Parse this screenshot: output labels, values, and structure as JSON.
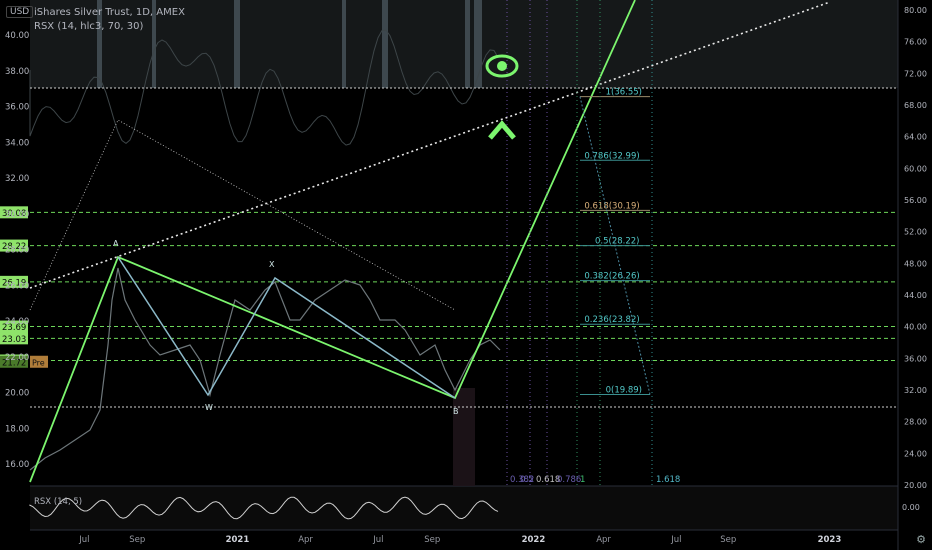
{
  "header": {
    "symbol_line": "iShares Silver Trust, 1D, AMEX",
    "indicator_line": "RSX (14, hlc3, 70, 30)",
    "currency": "USD"
  },
  "colors": {
    "bg": "#000000",
    "accent": "#7cf56e",
    "level": "#6dd65a",
    "fib_text": "#d8b07a",
    "fib_text_alt": "#52c7c7",
    "rsx_band": "#5e6f73"
  },
  "chart_data": {
    "type": "line",
    "price_axis_ticks": [
      16.0,
      18.0,
      20.0,
      22.0,
      24.0,
      26.0,
      28.0,
      30.0,
      32.0,
      34.0,
      36.0,
      38.0,
      40.0
    ],
    "rsx_axis_ticks": [
      "80.00",
      "76.00",
      "72.00",
      "68.00",
      "64.00",
      "60.00",
      "56.00",
      "52.00",
      "48.00",
      "44.00",
      "40.00",
      "36.00",
      "32.00",
      "28.00",
      "24.00",
      "20.00"
    ],
    "lower_pane_tick": "0.00",
    "time_labels": [
      "Jul",
      "Sep",
      "2021",
      "Apr",
      "Jul",
      "Sep",
      "2022",
      "Apr",
      "Jul",
      "Sep",
      "2023"
    ],
    "level_badges": [
      {
        "label": "30.08",
        "value": 30.08
      },
      {
        "label": "28.22",
        "value": 28.22
      },
      {
        "label": "26.19",
        "value": 26.19
      },
      {
        "label": "23.69",
        "value": 23.69
      },
      {
        "label": "23.03",
        "value": 23.03
      },
      {
        "label": "21.79",
        "value": 21.79
      },
      {
        "label": "21.72",
        "value": 21.72
      }
    ],
    "fib_levels": [
      {
        "label": "1(36.55)",
        "value": 36.55
      },
      {
        "label": "0.786(32.99)",
        "value": 32.99
      },
      {
        "label": "0.618(30.19)",
        "value": 30.19
      },
      {
        "label": "0.5(28.22)",
        "value": 28.22
      },
      {
        "label": "0.382(26.26)",
        "value": 26.26
      },
      {
        "label": "0.236(23.82)",
        "value": 23.82
      },
      {
        "label": "0(19.89)",
        "value": 19.89
      }
    ],
    "pattern_points": [
      {
        "label": "A",
        "value": 28.9
      },
      {
        "label": "W",
        "value": 20.8
      },
      {
        "label": "X",
        "value": 27.1
      },
      {
        "label": "B",
        "value": 19.9
      }
    ],
    "fib_time_labels": [
      "0.382",
      "0.5",
      "0.618",
      "0.786",
      "1",
      "1.618"
    ],
    "lower_indicator_label": "RSX (14, 5)"
  }
}
